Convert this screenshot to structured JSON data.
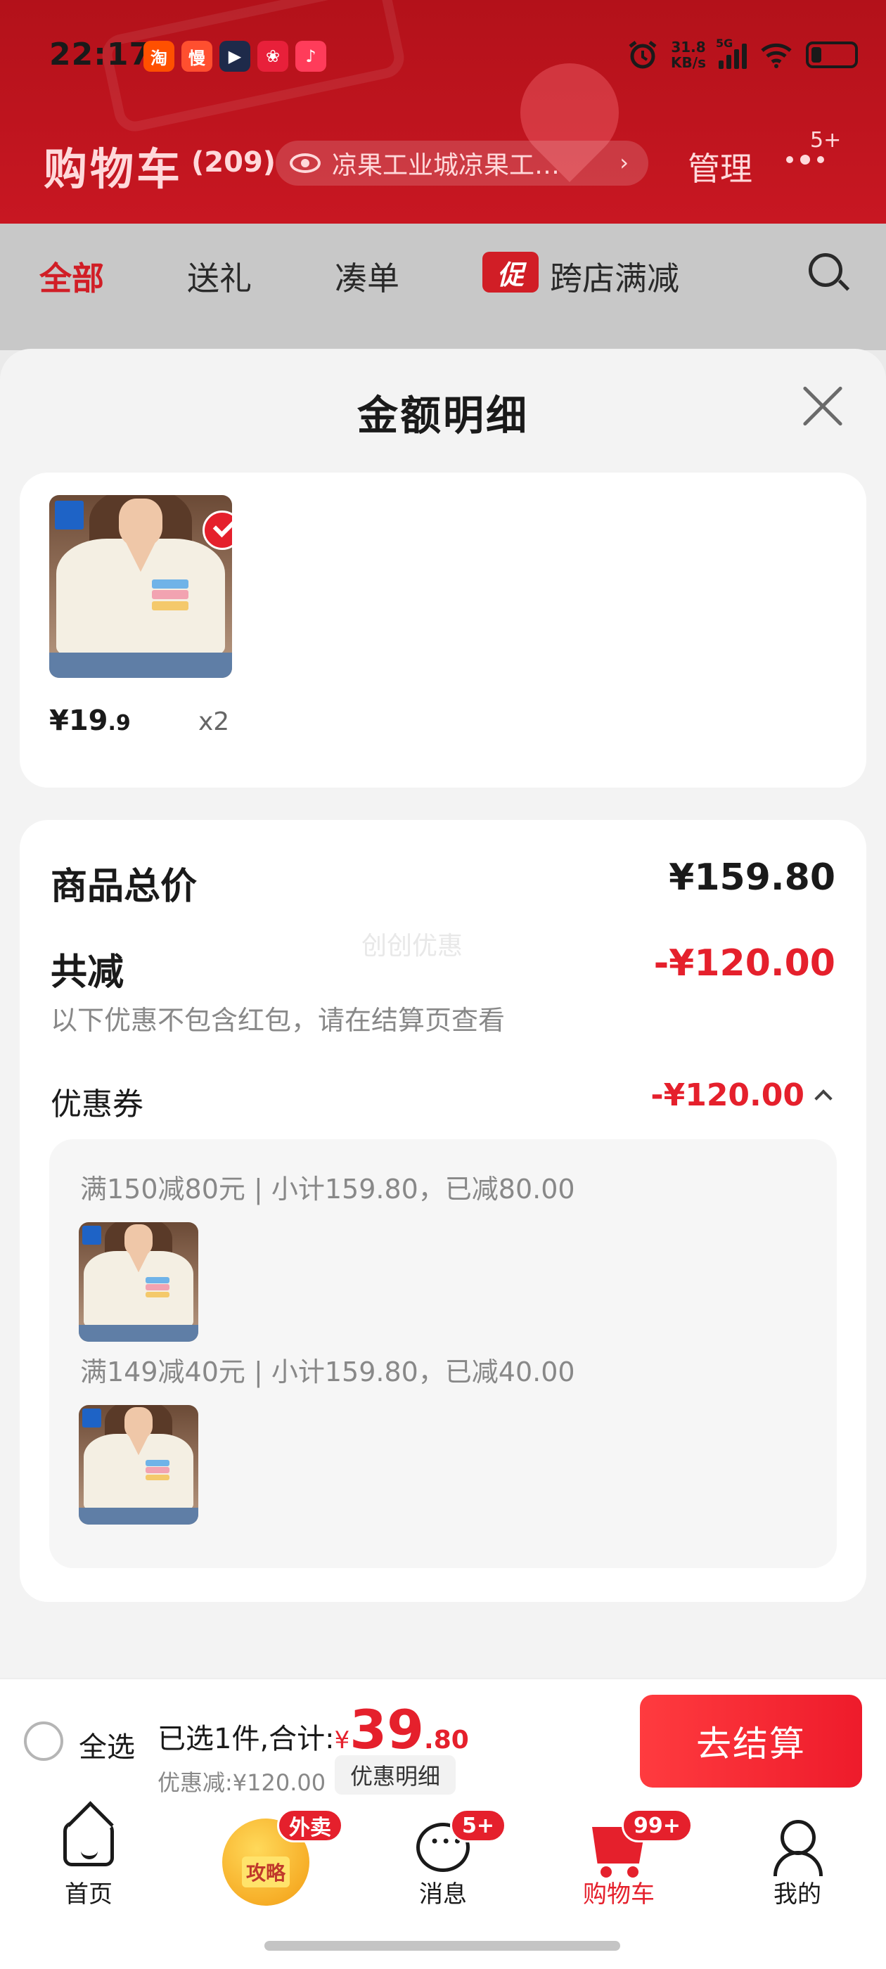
{
  "status_bar": {
    "time": "22:17",
    "app_icons": [
      {
        "name": "taobao-icon",
        "glyph": "淘",
        "color": "#ff5000"
      },
      {
        "name": "app-man-icon",
        "glyph": "慢",
        "color": "#ff4f2f"
      },
      {
        "name": "video-app-icon",
        "glyph": "▶",
        "color": "#1e2a4a"
      },
      {
        "name": "gift-app-icon",
        "glyph": "❀",
        "color": "#e8203a"
      },
      {
        "name": "douyin-icon",
        "glyph": "♪",
        "color": "#ff3c5a"
      }
    ],
    "net_speed": "31.8",
    "net_unit": "KB/s",
    "network": "5G"
  },
  "header": {
    "title": "购物车",
    "count": "(209)",
    "address": "凉果工业城凉果工…",
    "manage": "管理",
    "more_badge": "5+"
  },
  "tabs": {
    "all": "全部",
    "gift": "送礼",
    "combine": "凑单",
    "promo_tag": "促",
    "cross_store": "跨店满减"
  },
  "sheet": {
    "title": "金额明细",
    "item": {
      "price_int": "¥19",
      "price_dec": ".9",
      "qty": "x2"
    },
    "total_label": "商品总价",
    "total_value": "¥159.80",
    "reduce_label": "共减",
    "reduce_value": "-¥120.00",
    "watermark": "创创优惠",
    "note": "以下优惠不包含红包，请在结算页查看",
    "coupon_label": "优惠券",
    "coupon_value": "-¥120.00",
    "coupon_rules": [
      "满150减80元 | 小计159.80，已减80.00",
      "满149减40元 | 小计159.80，已减40.00"
    ]
  },
  "action_bar": {
    "select_all": "全选",
    "summary_prefix": "已选1件,合计:",
    "currency": "¥",
    "total_int": "39",
    "total_dec": ".80",
    "discount": "优惠减:¥120.00",
    "detail": "优惠明细",
    "checkout": "去结算"
  },
  "tab_bar": {
    "home": "首页",
    "center_icon_text": "攻略",
    "center_badge": "外卖",
    "messages": "消息",
    "messages_badge": "5+",
    "cart": "购物车",
    "cart_badge": "99+",
    "me": "我的"
  },
  "colors": {
    "brand_red": "#e5202c",
    "header_red": "#c81722"
  }
}
